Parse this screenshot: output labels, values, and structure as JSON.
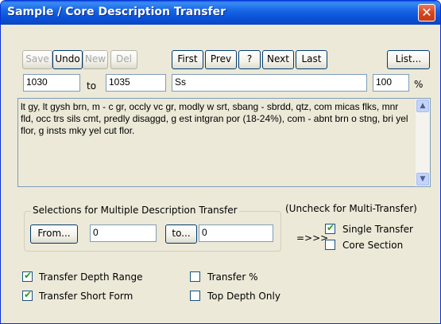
{
  "window": {
    "title": "Sample / Core Description Transfer",
    "close_glyph": "✕"
  },
  "toolbar": {
    "save": "Save",
    "undo": "Undo",
    "new": "New",
    "del": "Del",
    "first": "First",
    "prev": "Prev",
    "help": "?",
    "next": "Next",
    "last": "Last",
    "list": "List..."
  },
  "depth": {
    "from": "1030",
    "to_label": "to",
    "to": "1035"
  },
  "short_form": "Ss",
  "percent": {
    "value": "100",
    "unit": "%"
  },
  "description": "lt gy, lt gysh brn, m - c gr, occly vc gr, modly w srt, sbang - sbrdd, qtz, com micas flks, mnr fld, occ trs sils cmt, predly disaggd, g est intgran por (18-24%), com - abnt brn o stng, bri yel flor, g insts mky yel cut flor.",
  "multi": {
    "legend": "Selections for Multiple Description Transfer",
    "from_button": "From...",
    "from_value": "0",
    "to_button": "to...",
    "to_value": "0",
    "arrow": "=>>>"
  },
  "uncheck_note": "(Uncheck for Multi-Transfer)",
  "options": {
    "single_transfer": {
      "label": "Single Transfer",
      "checked": true
    },
    "core_section": {
      "label": "Core Section",
      "checked": false
    },
    "transfer_depth_range": {
      "label": "Transfer Depth Range",
      "checked": true
    },
    "transfer_short_form": {
      "label": "Transfer Short Form",
      "checked": true
    },
    "transfer_percent": {
      "label": "Transfer %",
      "checked": false
    },
    "top_depth_only": {
      "label": "Top Depth Only",
      "checked": false
    }
  },
  "icons": {
    "check": "✔",
    "scroll_up": "▲",
    "scroll_down": "▼"
  }
}
